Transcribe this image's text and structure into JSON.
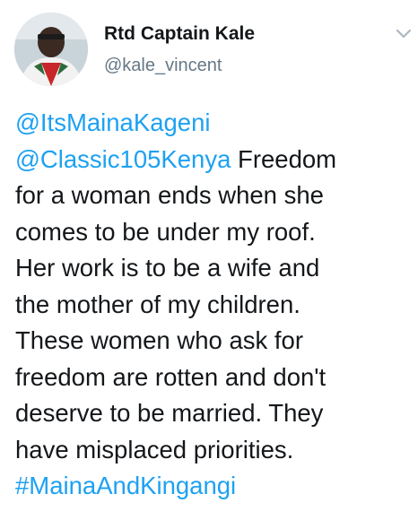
{
  "user": {
    "display_name": "Rtd Captain Kale",
    "handle": "@kale_vincent"
  },
  "icons": {
    "avatar": "profile-photo",
    "menu": "chevron-down-icon"
  },
  "colors": {
    "link": "#1da1f2",
    "text": "#14171a",
    "secondary": "#657786"
  },
  "tweet": {
    "mention_1": "@ItsMainaKageni",
    "mention_2": "@Classic105Kenya",
    "line_2_rest": " Freedom",
    "line_3": "for a woman ends when she",
    "line_4": "comes to be under my roof.",
    "line_5": "Her work is to be a wife and",
    "line_6": "the mother of my children.",
    "line_7": "These women who ask for",
    "line_8": "freedom are rotten and don't",
    "line_9": "deserve to be married. They",
    "line_10": "have misplaced priorities.",
    "hashtag": "#MainaAndKingangi"
  }
}
